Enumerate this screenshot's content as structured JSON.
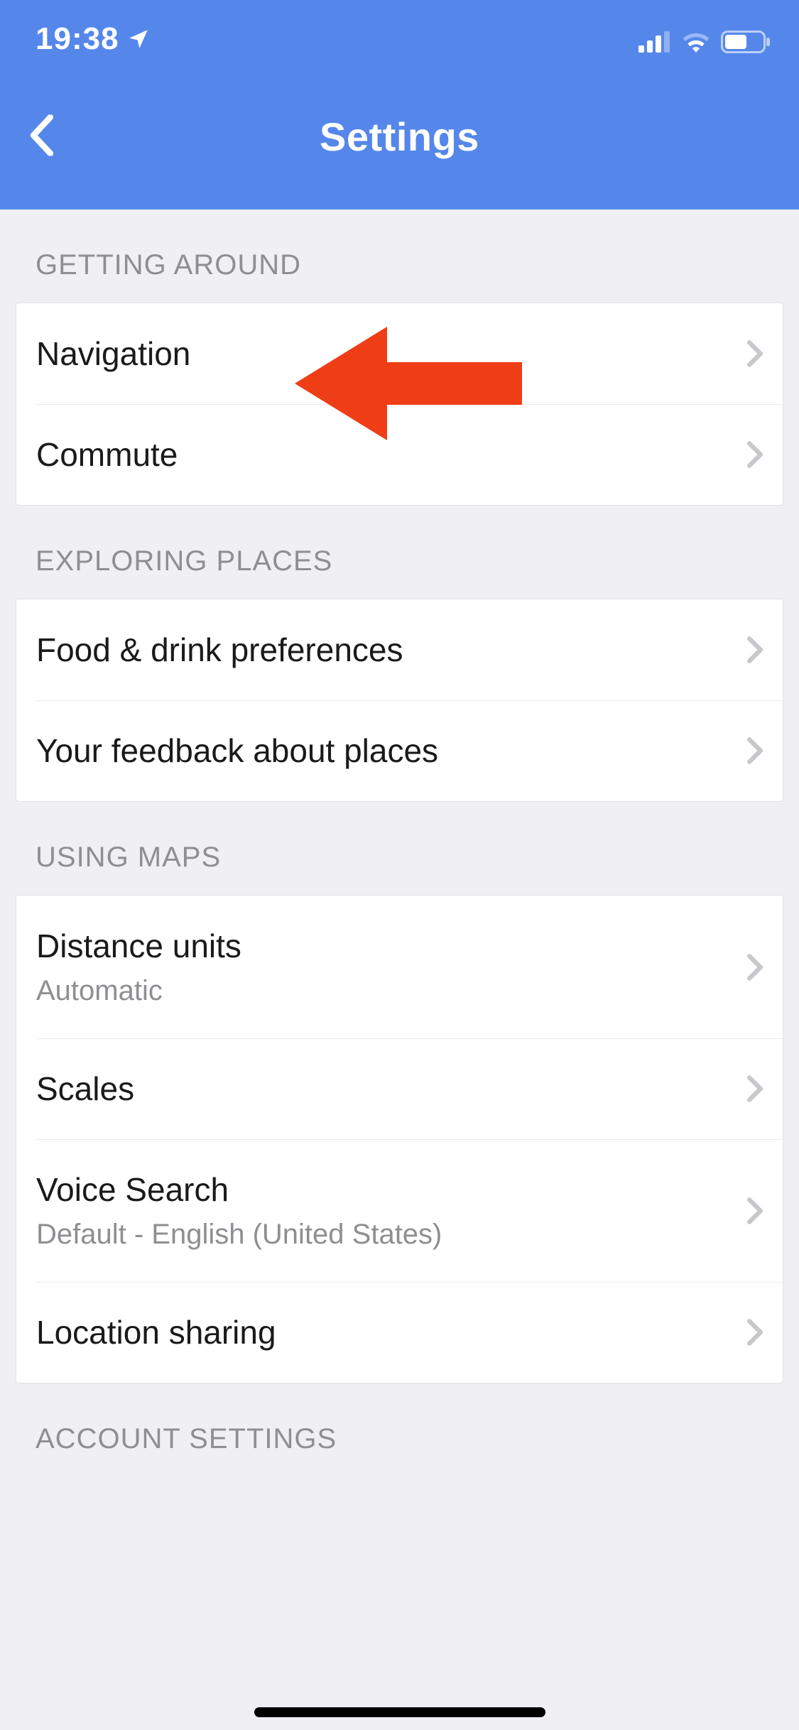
{
  "status": {
    "time": "19:38"
  },
  "header": {
    "title": "Settings"
  },
  "sections": {
    "getting_around": {
      "header": "GETTING AROUND",
      "items": [
        {
          "label": "Navigation"
        },
        {
          "label": "Commute"
        }
      ]
    },
    "exploring_places": {
      "header": "EXPLORING PLACES",
      "items": [
        {
          "label": "Food & drink preferences"
        },
        {
          "label": "Your feedback about places"
        }
      ]
    },
    "using_maps": {
      "header": "USING MAPS",
      "items": [
        {
          "label": "Distance units",
          "sub": "Automatic"
        },
        {
          "label": "Scales"
        },
        {
          "label": "Voice Search",
          "sub": "Default - English (United States)"
        },
        {
          "label": "Location sharing"
        }
      ]
    },
    "account_settings": {
      "header": "ACCOUNT SETTINGS"
    }
  }
}
